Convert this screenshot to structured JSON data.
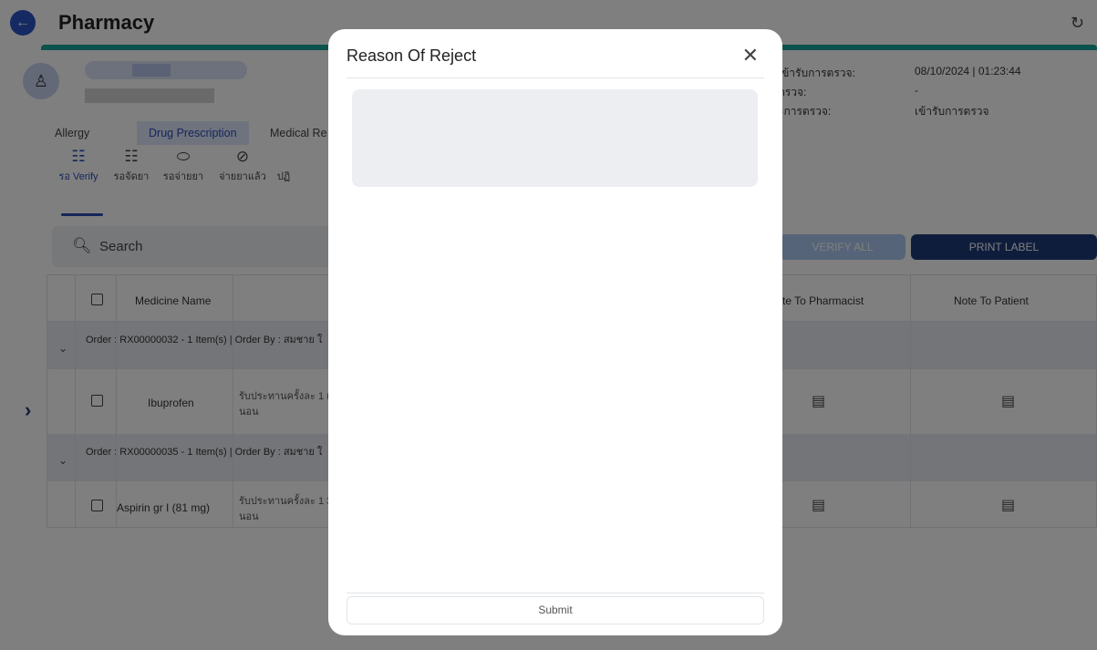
{
  "app": {
    "title": "Pharmacy",
    "back_icon": "back-arrow-icon",
    "refresh_icon": "refresh-icon",
    "accent_color": "#19a59a",
    "brand_color": "#1f3a7a"
  },
  "patient": {
    "meta": [
      {
        "label": "เข้ารับการตรวจ:",
        "value": "08/10/2024 | 01:23:44"
      },
      {
        "label": "ตรวจ:",
        "value": "-"
      },
      {
        "label": "ะการตรวจ:",
        "value": "เข้ารับการตรวจ"
      }
    ]
  },
  "tabs": [
    {
      "label": "Allergy"
    },
    {
      "label": "Drug Prescription"
    },
    {
      "label": "Medical Re"
    }
  ],
  "sub_tabs": [
    {
      "label": "รอ Verify",
      "icon": "clipboard-edit-icon"
    },
    {
      "label": "รอจัดยา",
      "icon": "clipboard-edit-icon"
    },
    {
      "label": "รอจ่ายยา",
      "icon": "pill-icon"
    },
    {
      "label": "จ่ายยาแล้ว",
      "icon": "check-circle-icon"
    },
    {
      "label": "ปฏิ",
      "icon": ""
    }
  ],
  "search": {
    "placeholder": "Search"
  },
  "actions": {
    "verify_all": "VERIFY ALL",
    "print_label": "PRINT LABEL"
  },
  "table": {
    "headers": {
      "medicine_name": "Medicine Name",
      "note_pharmacist": "te To Pharmacist",
      "note_patient": "Note To Patient"
    },
    "groups": [
      {
        "order": "Order : RX00000032 - 1 Item(s) | Order By : สมชาย  ใ",
        "medicine": "Ibuprofen",
        "instruction_1": "รับประทานครั้งละ 1 เม็",
        "instruction_2": "นอน"
      },
      {
        "order": "Order : RX00000035 - 1 Item(s) | Order By : สมชาย  ใ",
        "medicine": "Aspirin gr I (81 mg)",
        "instruction_1": "รับประทานครั้งละ 1  3",
        "instruction_2": "นอน"
      }
    ]
  },
  "modal": {
    "title": "Reason Of Reject",
    "close_icon": "close-icon",
    "reason_value": "",
    "submit_label": "Submit"
  }
}
